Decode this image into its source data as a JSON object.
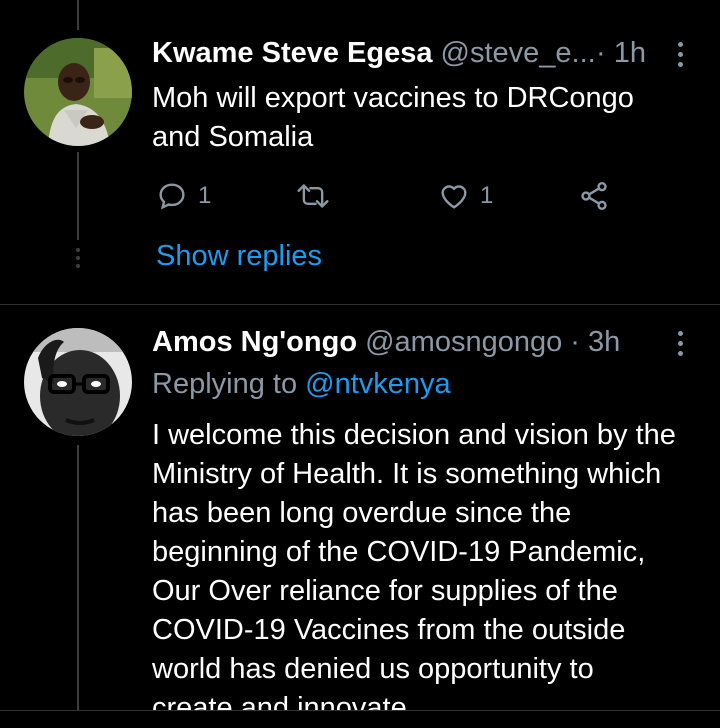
{
  "tweets": [
    {
      "name": "Kwame Steve Egesa",
      "handle": "@steve_e...",
      "time": "· 1h",
      "text_lines": [
        "Moh will export vaccines to DRCongo",
        "and Somalia"
      ],
      "reply_count": "1",
      "retweet_count": "",
      "like_count": "1",
      "show_replies": "Show replies"
    },
    {
      "name": "Amos Ng'ongo",
      "handle": "@amosngongo",
      "time": "· 3h",
      "replying_prefix": "Replying to",
      "replying_to": "@ntvkenya",
      "text_lines": [
        "I welcome this decision and vision by the",
        "Ministry of Health. It is something which",
        "has been long overdue since the",
        "beginning of the COVID-19 Pandemic,",
        "Our Over reliance for supplies of the",
        "COVID-19 Vaccines from the outside",
        "world has denied us opportunity to",
        "create and innovate..."
      ]
    }
  ],
  "colors": {
    "background": "#000000",
    "text": "#ffffff",
    "secondary": "#8b98a5",
    "accent": "#1d9bf0",
    "divider": "#2f3336"
  }
}
